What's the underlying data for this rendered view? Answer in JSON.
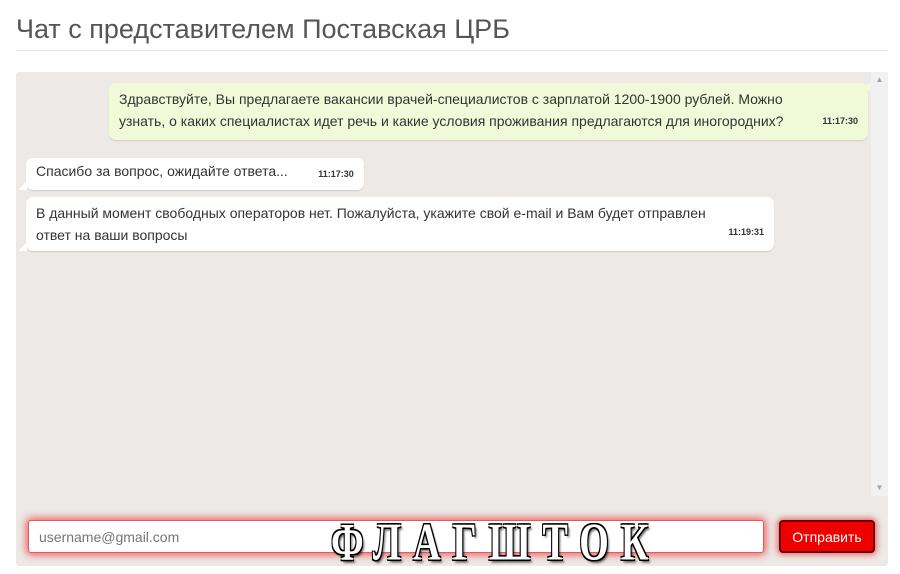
{
  "page": {
    "title": "Чат с представителем Поставская ЦРБ"
  },
  "chat": {
    "messages": [
      {
        "direction": "outgoing",
        "text": "Здравствуйте, Вы предлагаете вакансии врачей-специалистов с зарплатой 1200-1900 рублей. Можно узнать, о каких специалистах идет речь и какие условия проживания предлагаются для иногородних?",
        "time": "11:17:30"
      },
      {
        "direction": "incoming",
        "text": "Спасибо за вопрос, ожидайте ответа...",
        "time": "11:17:30"
      },
      {
        "direction": "incoming",
        "text": "В данный момент свободных операторов нет. Пожалуйста, укажите свой e-mail и Вам будет отправлен ответ на ваши вопросы",
        "time": "11:19:31"
      }
    ]
  },
  "composer": {
    "placeholder": "username@gmail.com",
    "send_label": "Отправить"
  },
  "watermark": {
    "text": "ФЛАГШТОК"
  },
  "colors": {
    "outgoing_bubble": "#f0fad9",
    "incoming_bubble": "#ffffff",
    "chat_background": "#ece9e6",
    "send_button": "#ee0000",
    "input_glow": "#f02828"
  },
  "icons": {
    "scroll_up": "triangle-up-icon",
    "scroll_down": "triangle-down-icon"
  }
}
